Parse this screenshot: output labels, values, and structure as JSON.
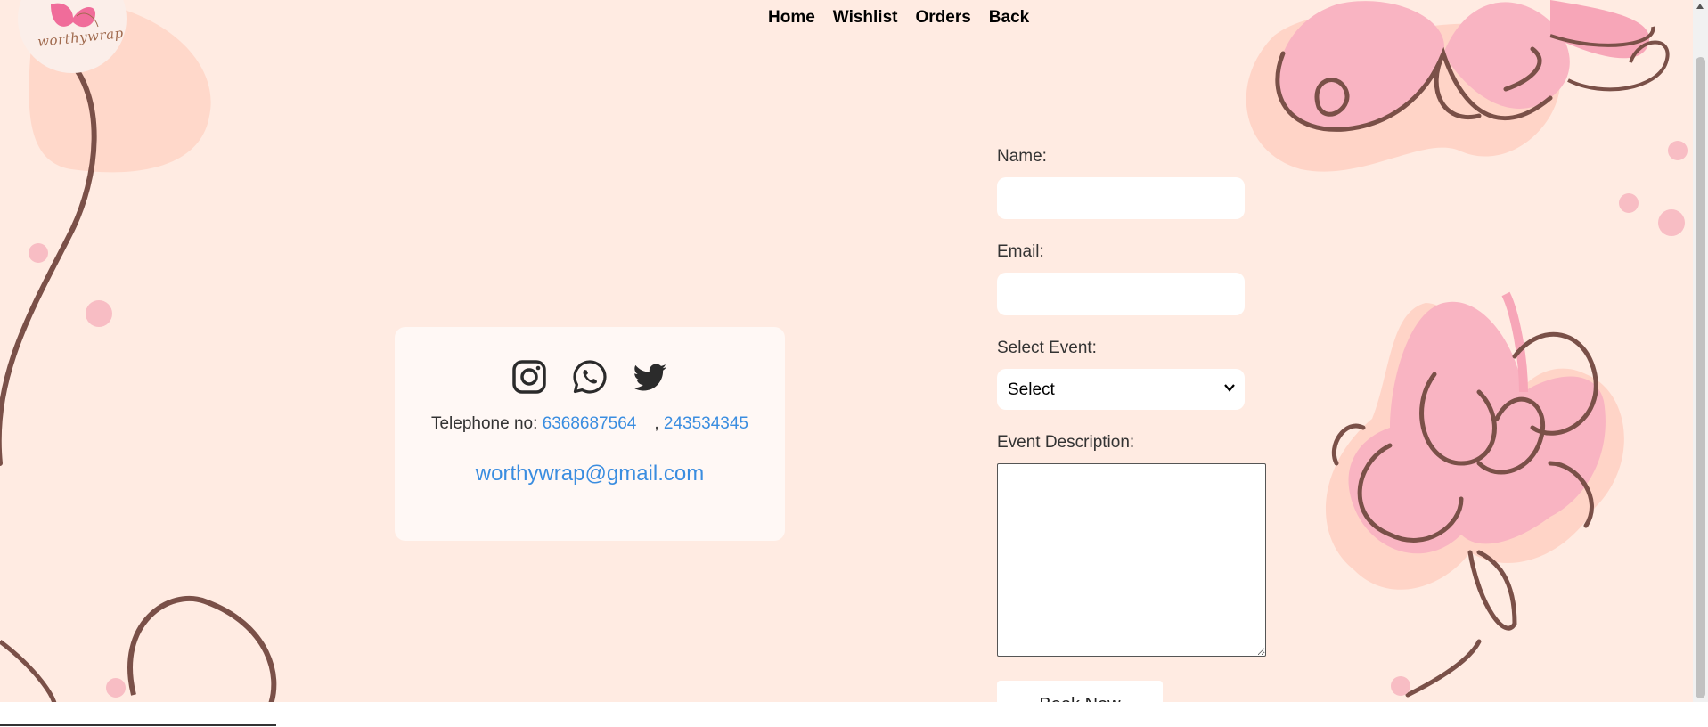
{
  "logo": {
    "text": "worthywrap"
  },
  "nav": {
    "home": "Home",
    "wishlist": "Wishlist",
    "orders": "Orders",
    "back": "Back"
  },
  "contact": {
    "icons": [
      "instagram-icon",
      "whatsapp-icon",
      "twitter-icon"
    ],
    "telephone_label": "Telephone no:",
    "phone1": "6368687564",
    "separator": ",",
    "phone2": "243534345",
    "email": "worthywrap@gmail.com"
  },
  "form": {
    "name_label": "Name:",
    "name_value": "",
    "email_label": "Email:",
    "email_value": "",
    "event_label": "Select Event:",
    "event_selected": "Select",
    "description_label": "Event Description:",
    "description_value": "",
    "submit_label": "Book Now"
  },
  "colors": {
    "background": "#ffebe2",
    "link": "#3a8de0",
    "butterfly_pink": "#f9b4c2",
    "outline": "#7a5048",
    "card": "#fff8f5"
  }
}
